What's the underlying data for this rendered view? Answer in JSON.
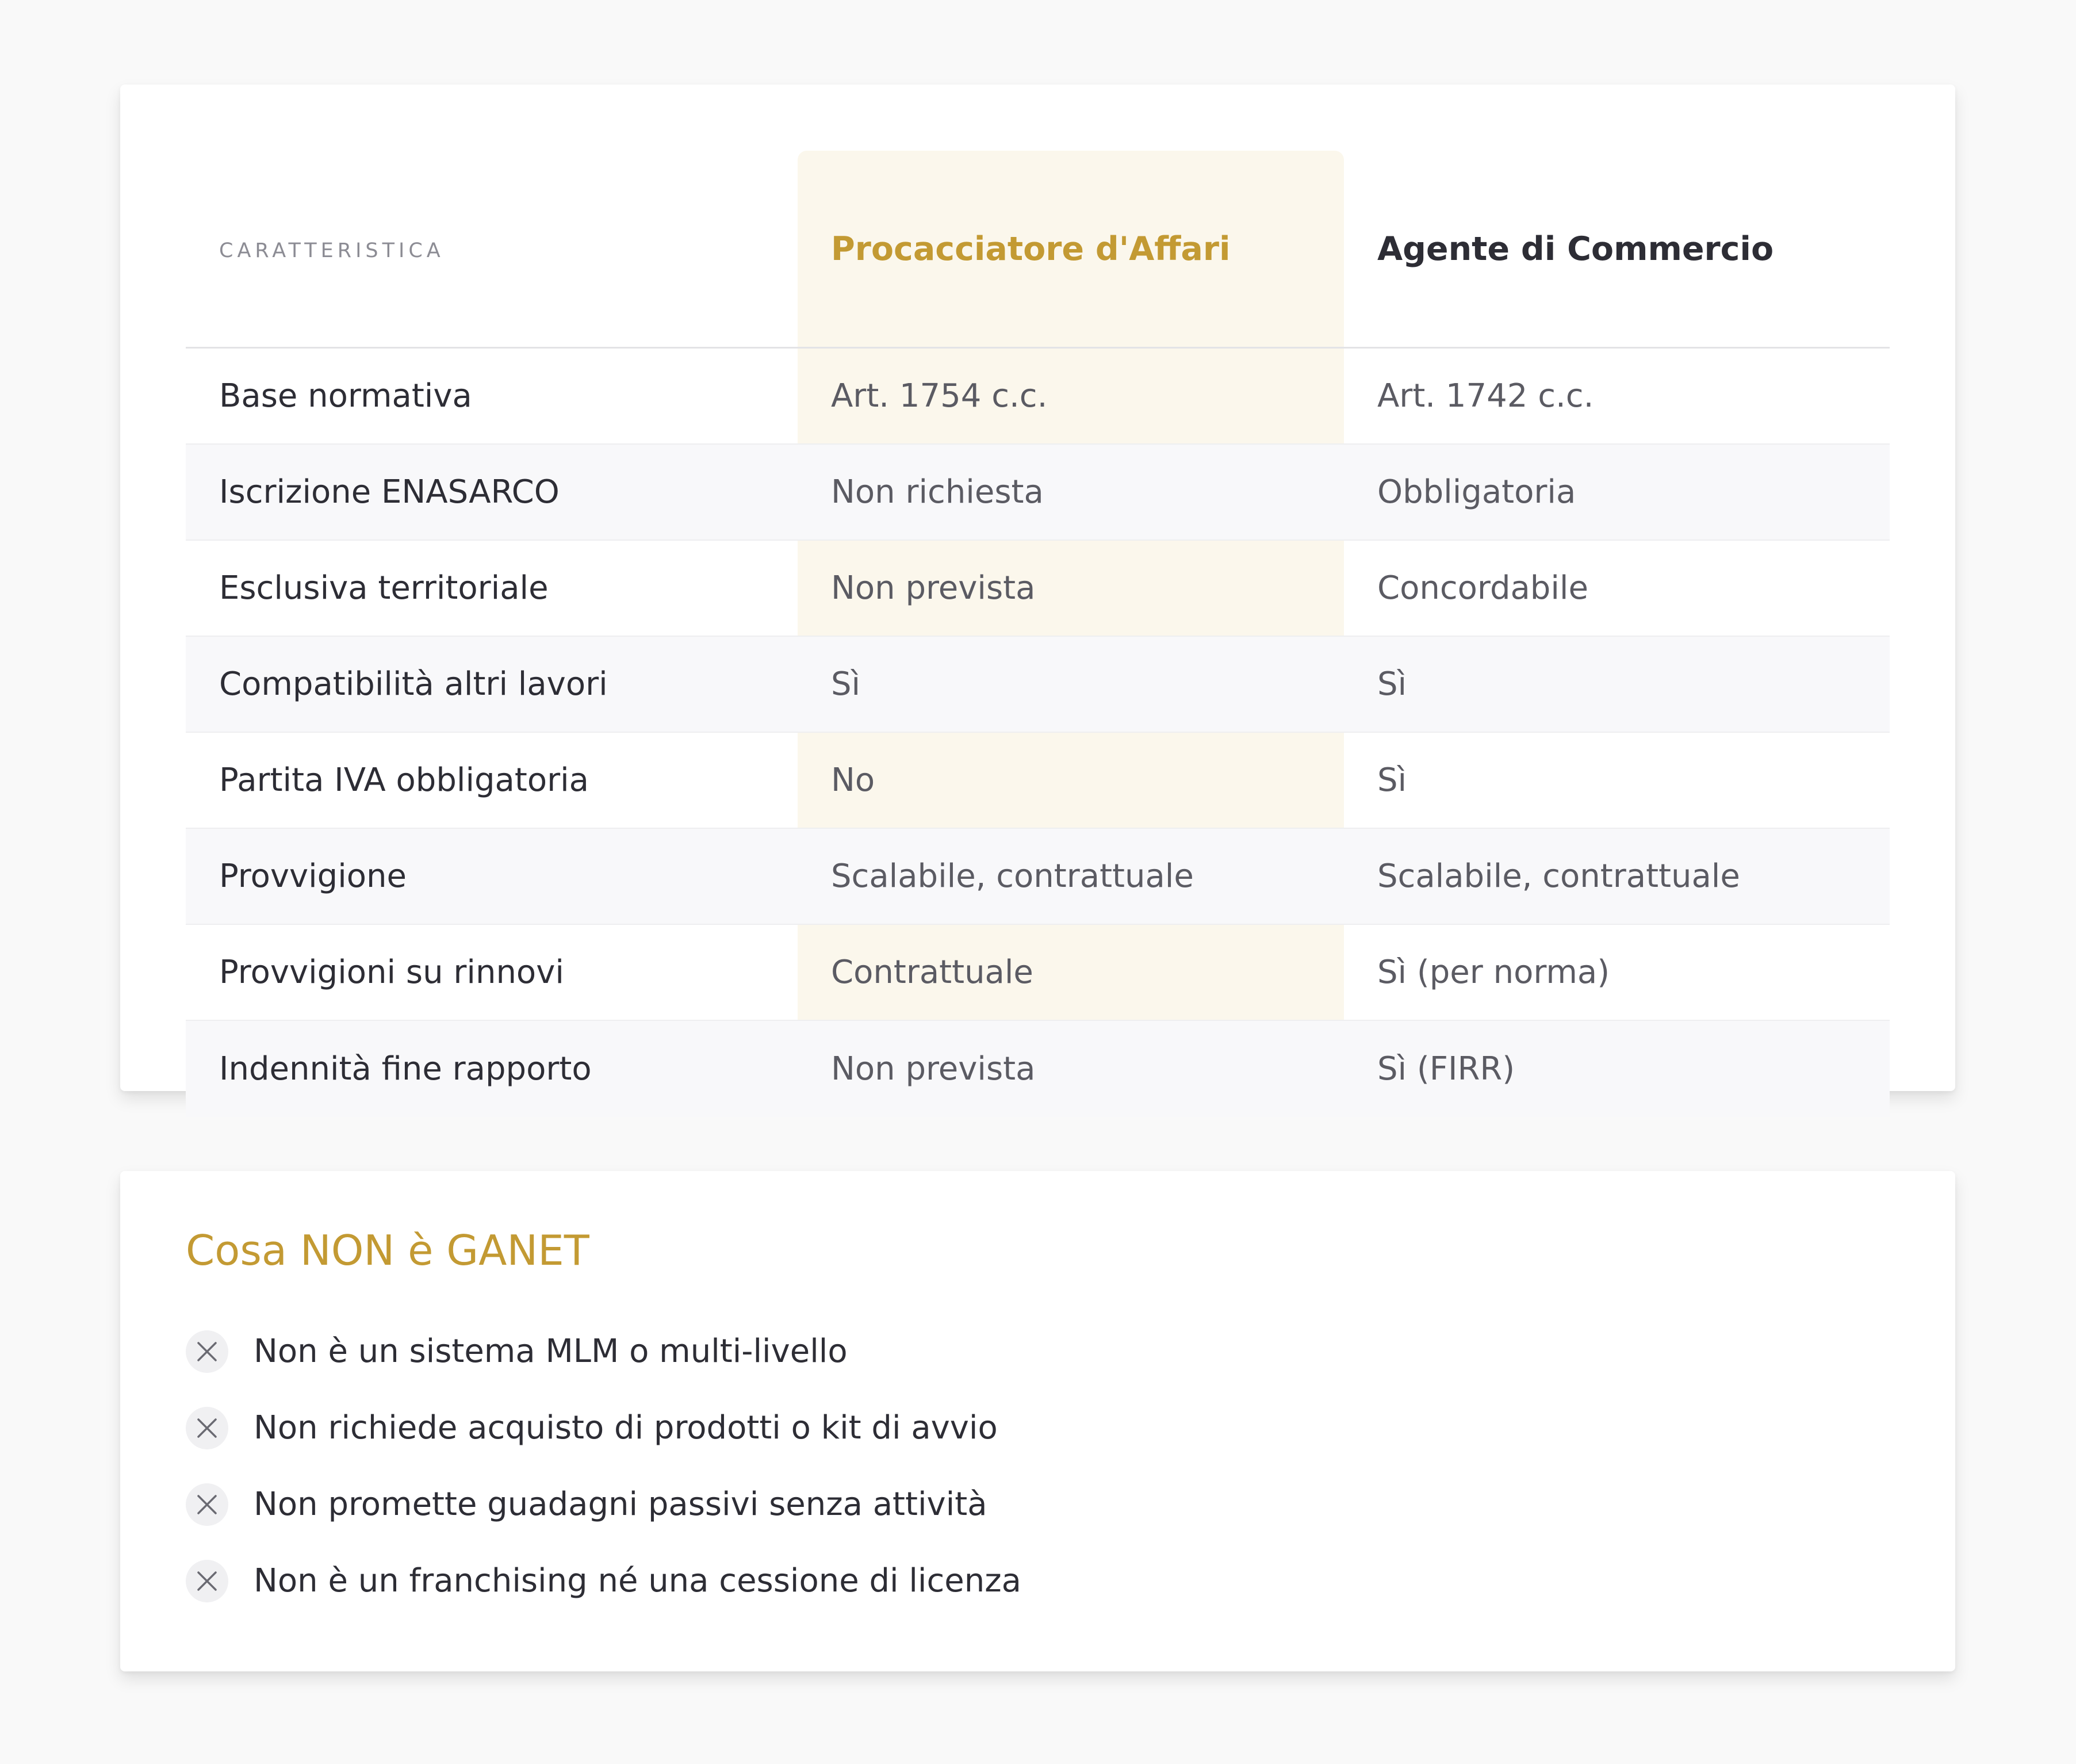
{
  "comparison": {
    "header": {
      "feature_label": "CARATTERISTICA",
      "col1_label": "Procacciatore d'Affari",
      "col2_label": "Agente di Commercio"
    },
    "rows": [
      {
        "feature": "Base normativa",
        "procacciatore": "Art. 1754 c.c.",
        "agente": "Art. 1742 c.c."
      },
      {
        "feature": "Iscrizione ENASARCO",
        "procacciatore": "Non richiesta",
        "agente": "Obbligatoria"
      },
      {
        "feature": "Esclusiva territoriale",
        "procacciatore": "Non prevista",
        "agente": "Concordabile"
      },
      {
        "feature": "Compatibilità altri lavori",
        "procacciatore": "Sì",
        "agente": "Sì"
      },
      {
        "feature": "Partita IVA obbligatoria",
        "procacciatore": "No",
        "agente": "Sì"
      },
      {
        "feature": "Provvigione",
        "procacciatore": "Scalabile, contrattuale",
        "agente": "Scalabile, contrattuale"
      },
      {
        "feature": "Provvigioni su rinnovi",
        "procacciatore": "Contrattuale",
        "agente": "Sì (per norma)"
      },
      {
        "feature": "Indennità fine rapporto",
        "procacciatore": "Non prevista",
        "agente": "Sì (FIRR)"
      }
    ]
  },
  "not_section": {
    "title": "Cosa NON è GANET",
    "items": [
      {
        "icon": "close-icon",
        "text": "Non è un sistema MLM o multi-livello"
      },
      {
        "icon": "close-icon",
        "text": "Non richiede acquisto di prodotti o kit di avvio"
      },
      {
        "icon": "close-icon",
        "text": "Non promette guadagni passivi senza attività"
      },
      {
        "icon": "close-icon",
        "text": "Non è un franchising né una cessione di licenza"
      }
    ]
  },
  "colors": {
    "accent_gold": "#c39a33",
    "highlight_column": "#fbf7ec",
    "text_dark": "#2d2d35",
    "text_muted": "#5b5b63"
  }
}
